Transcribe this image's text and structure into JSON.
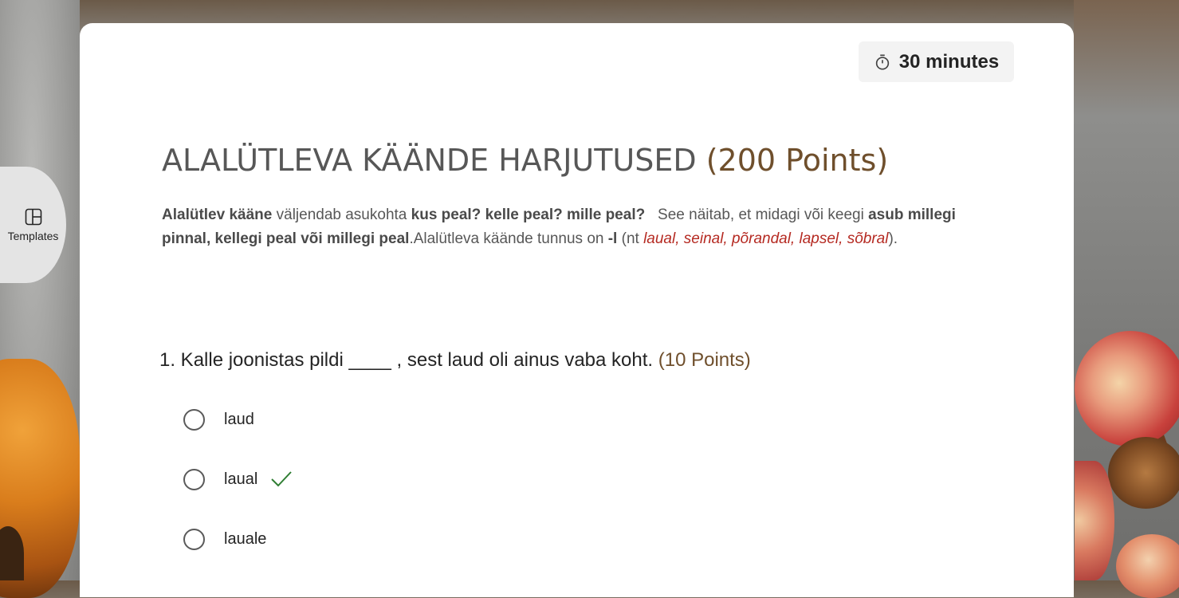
{
  "timer": {
    "label": "30 minutes",
    "icon": "stopwatch-icon"
  },
  "quiz": {
    "title": "ALALÜTLEVA KÄÄNDE HARJUTUSED",
    "title_points": "(200 Points)",
    "description": {
      "p1_bold": "Alalütlev kääne",
      "p2": " väljendab asukohta ",
      "p3_bold": "kus peal? kelle peal? mille peal?",
      "p4": "   See näitab, et midagi või keegi ",
      "p5_bold": "asub millegi pinnal, kellegi peal või millegi peal",
      "p6": ".Alalütleva käände tunnus on ",
      "p7_bold": "-l",
      "p8": " (nt ",
      "p9_italic": "laual, seinal, põrandal, lapsel, sõbral",
      "p10": ")."
    }
  },
  "question": {
    "text": "1. Kalle joonistas pildi ____ , sest laud oli ainus vaba koht.",
    "points": "(10 Points)",
    "options": [
      {
        "label": "laud",
        "correct": false
      },
      {
        "label": "laual",
        "correct": true
      },
      {
        "label": "lauale",
        "correct": false
      }
    ]
  },
  "sidebar": {
    "templates_label": "Templates",
    "icon": "templates-icon"
  },
  "colors": {
    "points_brown": "#6f4f2c",
    "example_red": "#b52a22",
    "check_green": "#2e7d32"
  }
}
